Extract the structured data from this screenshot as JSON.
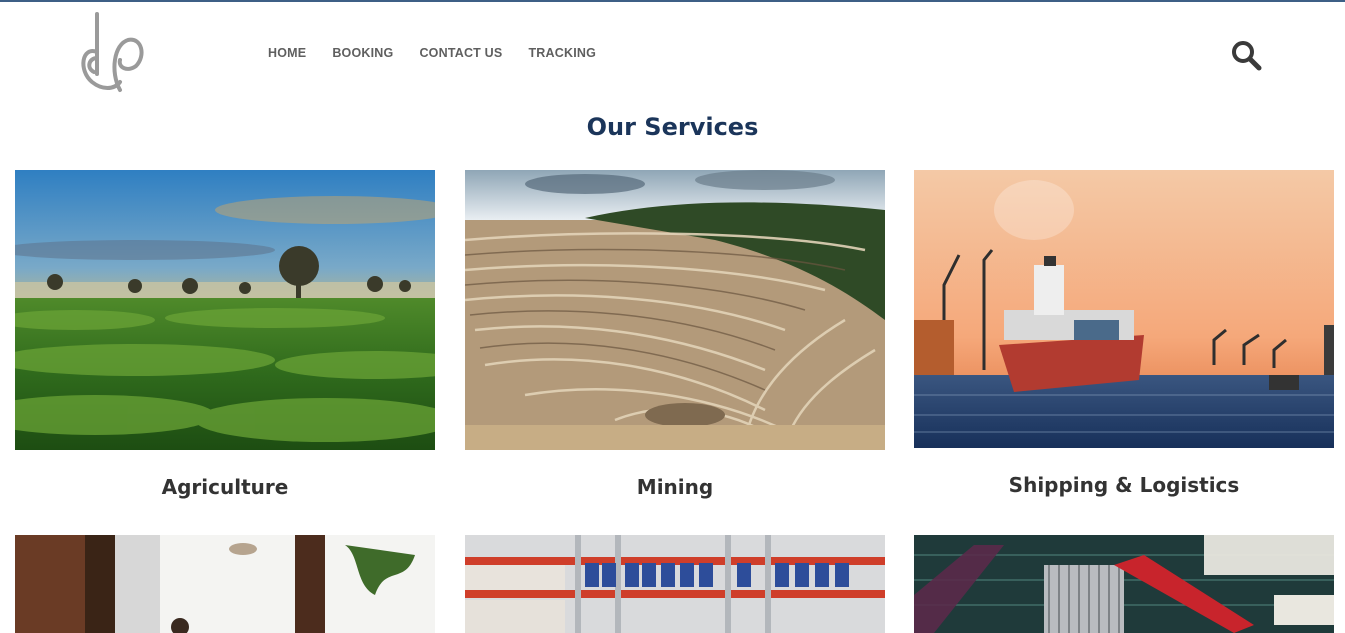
{
  "nav": {
    "items": [
      {
        "label": "HOME"
      },
      {
        "label": "BOOKING"
      },
      {
        "label": "CONTACT US"
      },
      {
        "label": "TRACKING"
      }
    ]
  },
  "header": {
    "logo_icon": "ekp-monogram-logo",
    "search_icon": "search-icon"
  },
  "main": {
    "title": "Our Services",
    "services": [
      {
        "label": "Agriculture",
        "image": "tea-field-sunset"
      },
      {
        "label": "Mining",
        "image": "open-pit-mine"
      },
      {
        "label": "Shipping & Logistics",
        "image": "cargo-ship-port"
      },
      {
        "label": "",
        "image": "office-interior"
      },
      {
        "label": "",
        "image": "warehouse-shelves"
      },
      {
        "label": "",
        "image": "circuit-board"
      }
    ]
  },
  "colors": {
    "accent_line": "#3d5f86",
    "title": "#1b355a",
    "nav_text": "#5f5f5f",
    "label_text": "#333333"
  }
}
